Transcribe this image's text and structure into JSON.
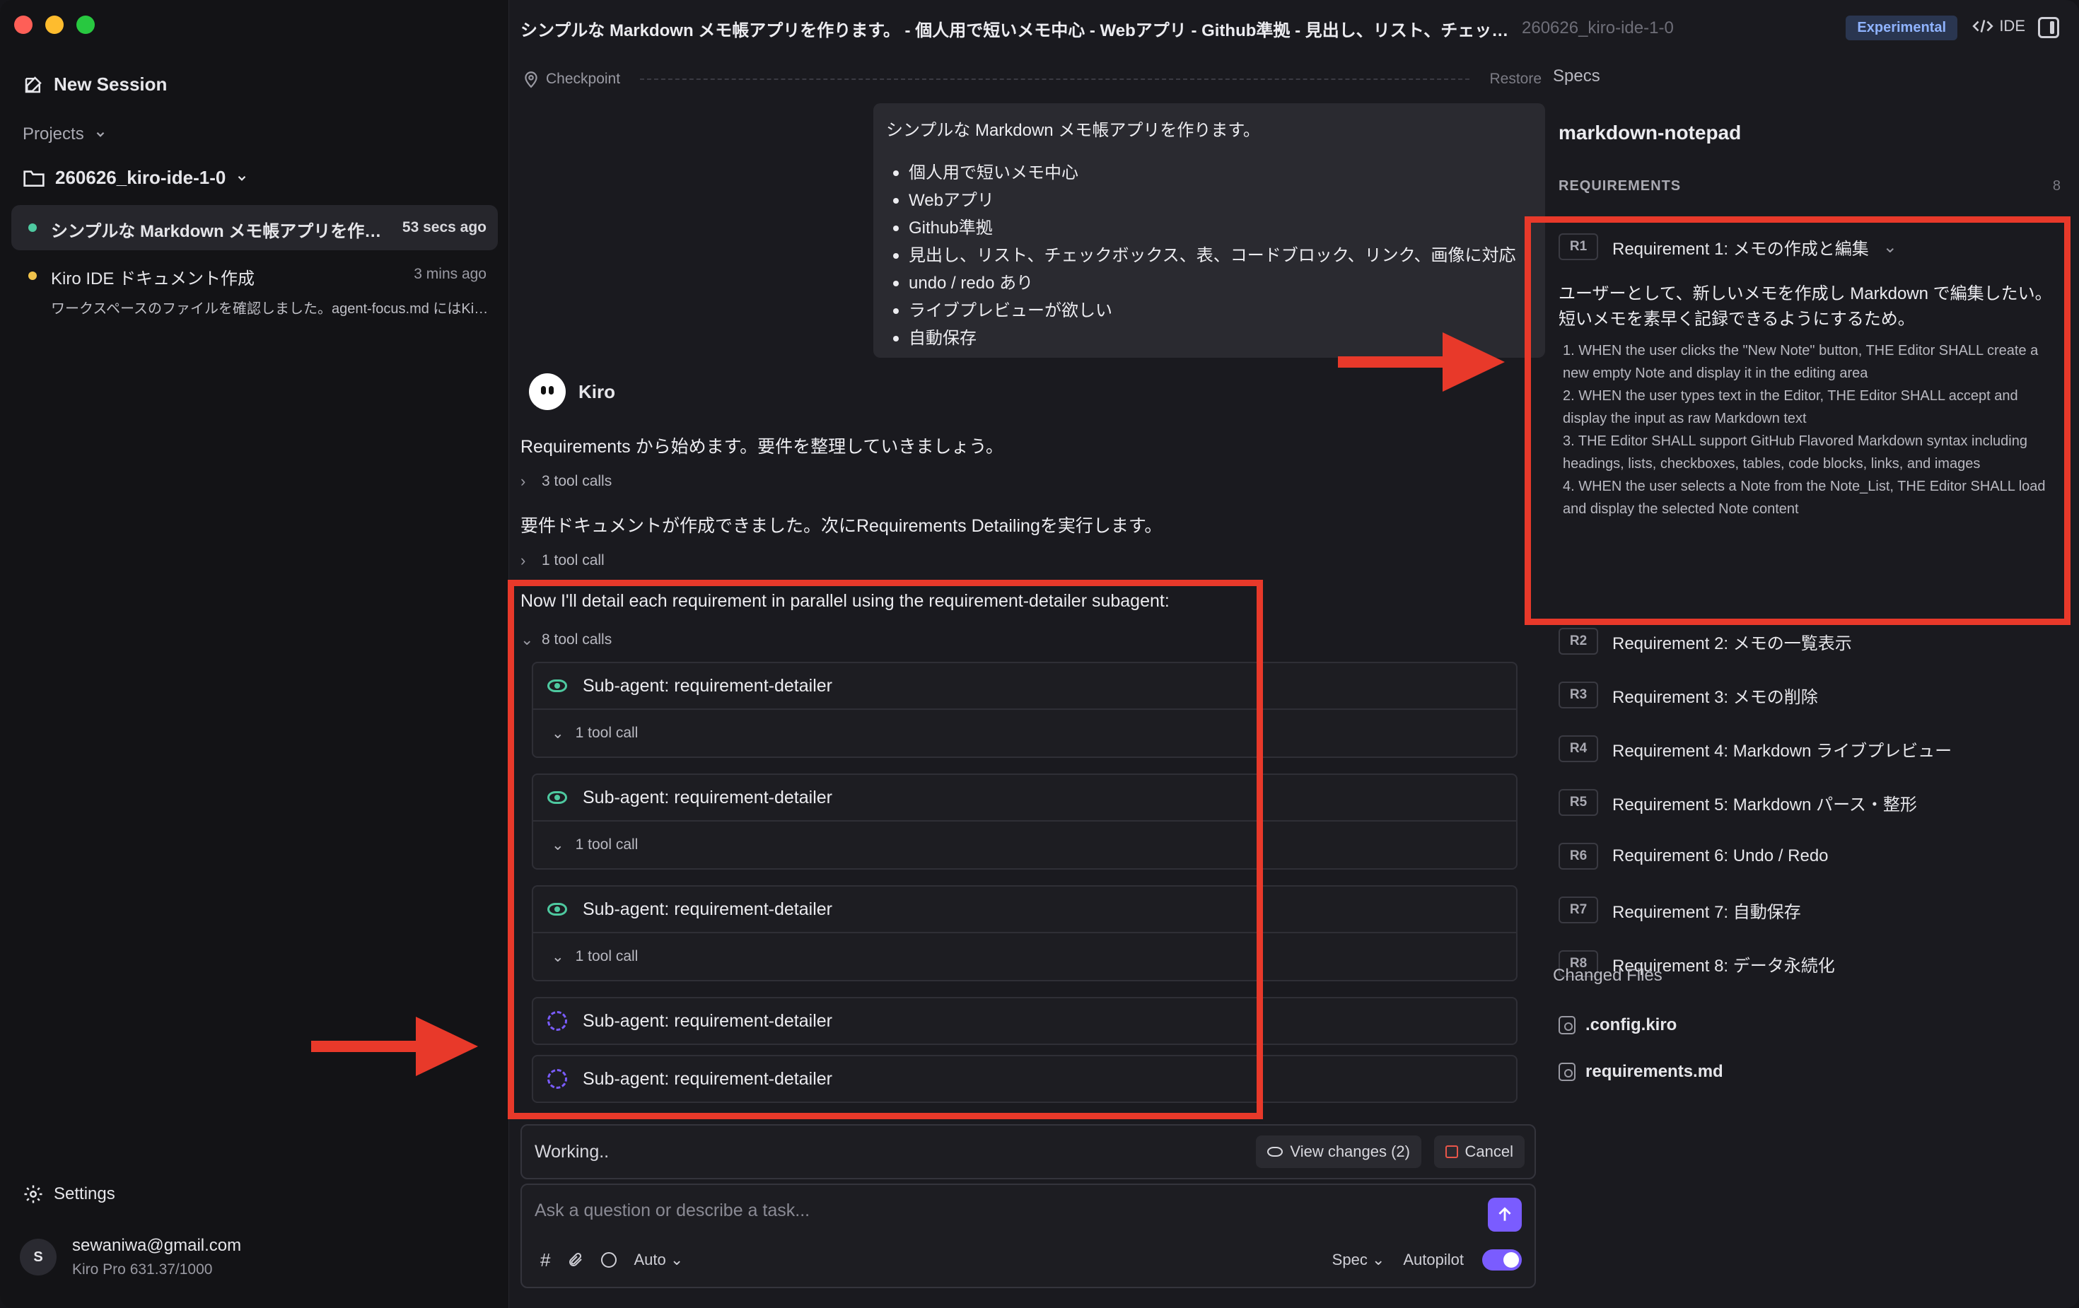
{
  "window": {
    "title": "シンプルな Markdown メモ帳アプリを作ります。 - 個人用で短いメモ中心 - Webアプリ - Github準拠 - 見出し、リスト、チェックボ...",
    "project_tag": "260626_kiro-ide-1-0",
    "experimental_label": "Experimental",
    "ide_label": "IDE"
  },
  "sidebar": {
    "new_session": "New Session",
    "projects": "Projects",
    "project_name": "260626_kiro-ide-1-0",
    "sessions": [
      {
        "title": "シンプルな Markdown メモ帳アプリを作り...",
        "time": "53 secs ago",
        "color": "#4ec9a0"
      },
      {
        "title": "Kiro IDE ドキュメント作成",
        "time": "3 mins ago",
        "sub": "ワークスペースのファイルを確認しました。agent-focus.md にはKir...",
        "color": "#f0c24b"
      }
    ],
    "settings": "Settings",
    "user": {
      "initial": "S",
      "email": "sewaniwa@gmail.com",
      "plan": "Kiro Pro 631.37/1000"
    }
  },
  "chat": {
    "checkpoint": "Checkpoint",
    "restore": "Restore",
    "user_message": {
      "intro": "シンプルな Markdown メモ帳アプリを作ります。",
      "bullets": [
        "個人用で短いメモ中心",
        "Webアプリ",
        "Github準拠",
        "見出し、リスト、チェックボックス、表、コードブロック、リンク、画像に対応",
        "undo / redo あり",
        "ライブプレビューが欲しい",
        "自動保存"
      ]
    },
    "agent_name": "Kiro",
    "msg1": "Requirements から始めます。要件を整理していきましょう。",
    "tool1": "3 tool calls",
    "msg2": "要件ドキュメントが作成できました。次にRequirements Detailingを実行します。",
    "tool2": "1 tool call",
    "msg3": "Now I'll detail each requirement in parallel using the requirement-detailer subagent:",
    "tool3": "8 tool calls",
    "subagents": [
      {
        "label": "Sub-agent: requirement-detailer",
        "status": "done",
        "tool": "1 tool call"
      },
      {
        "label": "Sub-agent: requirement-detailer",
        "status": "done",
        "tool": "1 tool call"
      },
      {
        "label": "Sub-agent: requirement-detailer",
        "status": "done",
        "tool": "1 tool call"
      },
      {
        "label": "Sub-agent: requirement-detailer",
        "status": "running"
      },
      {
        "label": "Sub-agent: requirement-detailer",
        "status": "running"
      }
    ],
    "working": "Working..",
    "view_changes": "View changes (2)",
    "cancel": "Cancel",
    "composer_placeholder": "Ask a question or describe a task...",
    "mode_auto": "Auto",
    "mode_spec": "Spec",
    "autopilot": "Autopilot",
    "autopilot_on": true
  },
  "specs": {
    "label": "Specs",
    "name": "markdown-notepad",
    "requirements_heading": "REQUIREMENTS",
    "requirements_count": "8",
    "r1": {
      "id": "R1",
      "title": "Requirement 1: メモの作成と編集",
      "description": "ユーザーとして、新しいメモを作成し Markdown で編集したい。短いメモを素早く記録できるようにするため。",
      "criteria": [
        "1. WHEN the user clicks the \"New Note\" button, THE Editor SHALL create a new empty Note and display it in the editing area",
        "2. WHEN the user types text in the Editor, THE Editor SHALL accept and display the input as raw Markdown text",
        "3. THE Editor SHALL support GitHub Flavored Markdown syntax including headings, lists, checkboxes, tables, code blocks, links, and images",
        "4. WHEN the user selects a Note from the Note_List, THE Editor SHALL load and display the selected Note content"
      ]
    },
    "requirements": [
      {
        "id": "R2",
        "title": "Requirement 2: メモの一覧表示"
      },
      {
        "id": "R3",
        "title": "Requirement 3: メモの削除"
      },
      {
        "id": "R4",
        "title": "Requirement 4: Markdown ライブプレビュー"
      },
      {
        "id": "R5",
        "title": "Requirement 5: Markdown パース・整形"
      },
      {
        "id": "R6",
        "title": "Requirement 6: Undo / Redo"
      },
      {
        "id": "R7",
        "title": "Requirement 7: 自動保存"
      },
      {
        "id": "R8",
        "title": "Requirement 8: データ永続化"
      }
    ],
    "changed_files_heading": "Changed Files",
    "changed_files": [
      ".config.kiro",
      "requirements.md"
    ]
  },
  "colors": {
    "accent": "#7a5cff",
    "annotation": "#e8392a",
    "success": "#4ec9a0"
  }
}
